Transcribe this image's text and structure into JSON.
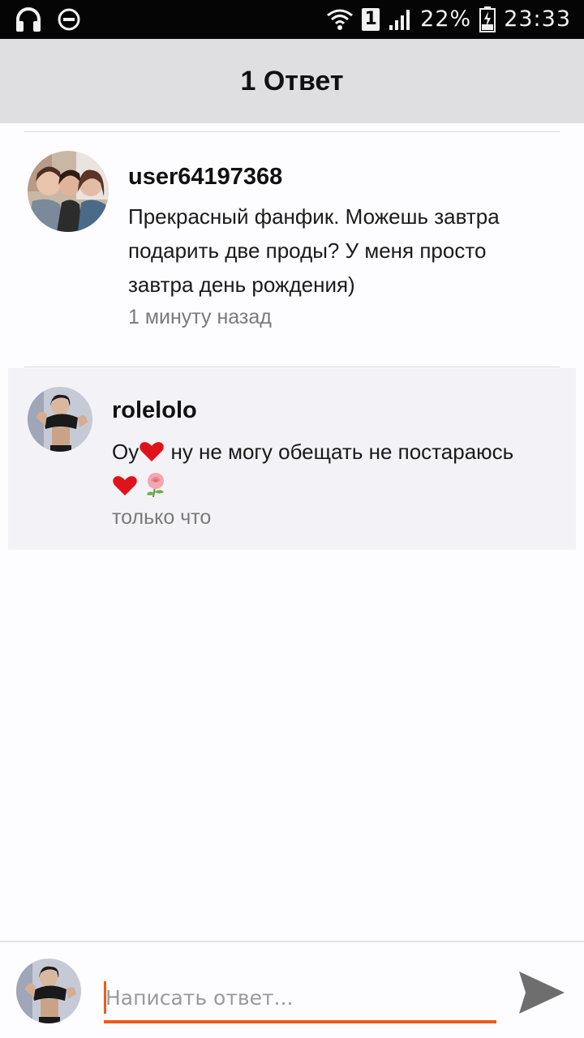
{
  "status_bar": {
    "battery": "22%",
    "time": "23:33",
    "sim_slot": "1",
    "icons": [
      "headphones-icon",
      "do-not-disturb-icon",
      "wifi-icon",
      "signal-icon",
      "battery-icon"
    ]
  },
  "header": {
    "title": "1 Ответ"
  },
  "comment": {
    "username": "user64197368",
    "text_lines": [
      "Прекрасный фанфик. Можешь завтра",
      "подарить две проды? У меня просто",
      "завтра день рождения)"
    ],
    "timestamp": "1 минуту назад"
  },
  "reply": {
    "username": "rolelolo",
    "text_prefix": "Оу",
    "text_main": " ну не могу обещать не постараюсь",
    "timestamp": "только что",
    "emoji": [
      "heart-icon",
      "heart-icon",
      "rose-icon"
    ]
  },
  "composer": {
    "placeholder": "Написать ответ...",
    "value": ""
  },
  "colors": {
    "accent": "#ef5a1a",
    "header_bg": "#dfdee0",
    "reply_bg": "#f3f2f6",
    "heart": "#e0121a"
  }
}
